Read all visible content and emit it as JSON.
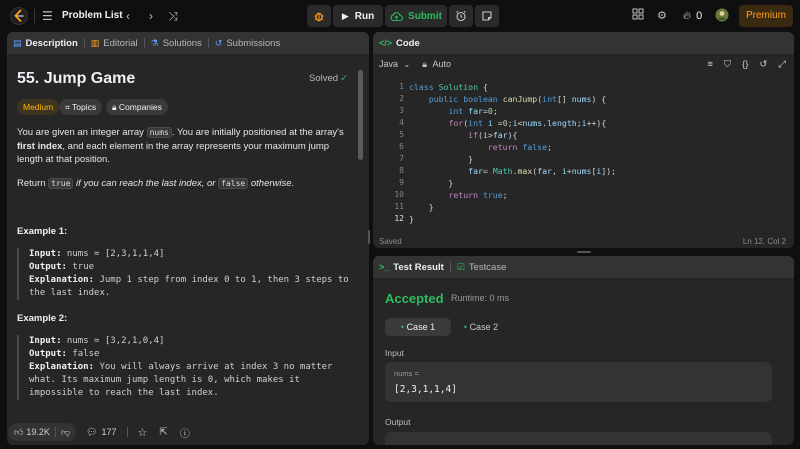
{
  "topbar": {
    "problem_list_label": "Problem List",
    "run_label": "Run",
    "submit_label": "Submit",
    "streak_count": "0",
    "premium_label": "Premium"
  },
  "description": {
    "tabs": [
      {
        "label": "Description"
      },
      {
        "label": "Editorial"
      },
      {
        "label": "Solutions"
      },
      {
        "label": "Submissions"
      }
    ],
    "title": "55. Jump Game",
    "status": "Solved",
    "difficulty": "Medium",
    "topics_label": "Topics",
    "companies_label": "Companies",
    "p1_a": "You are given an integer array ",
    "p1_code": "nums",
    "p1_b": ". You are initially positioned at the array's ",
    "p1_bold": "first index",
    "p1_c": ", and each element in the array represents your maximum jump length at that position.",
    "p2_a": "Return ",
    "p2_code1": "true",
    "p2_b": " if you can reach the last index, or ",
    "p2_code2": "false",
    "p2_c": " otherwise.",
    "examples": [
      {
        "title": "Example 1:",
        "input_label": "Input:",
        "input": " nums = [2,3,1,1,4]",
        "output_label": "Output:",
        "output": " true",
        "explanation_label": "Explanation:",
        "explanation": " Jump 1 step from index 0 to 1, then 3 steps to the last index."
      },
      {
        "title": "Example 2:",
        "input_label": "Input:",
        "input": " nums = [3,2,1,0,4]",
        "output_label": "Output:",
        "output": " false",
        "explanation_label": "Explanation:",
        "explanation": " You will always arrive at index 3 no matter what. Its maximum jump length is 0, which makes it impossible to reach the last index."
      }
    ],
    "likes": "19.2K",
    "comments": "177"
  },
  "code": {
    "tab_label": "Code",
    "language": "Java",
    "mode": "Auto",
    "line_numbers": [
      "1",
      "2",
      "3",
      "4",
      "5",
      "6",
      "7",
      "8",
      "9",
      "10",
      "11",
      "12"
    ],
    "status": "Saved",
    "cursor": "Ln 12, Col 2"
  },
  "result": {
    "tab_label": "Test Result",
    "testcase_tab_label": "Testcase",
    "verdict": "Accepted",
    "runtime": "Runtime: 0 ms",
    "cases": [
      {
        "label": "Case 1"
      },
      {
        "label": "Case 2"
      }
    ],
    "input_heading": "Input",
    "var_name": "nums =",
    "var_value": "[2,3,1,1,4]",
    "output_heading": "Output"
  },
  "colors": {
    "accent_orange": "#ffa116",
    "accepted_green": "#2cbb5d",
    "panel_bg": "#262626",
    "page_bg": "#0f0f0f"
  }
}
